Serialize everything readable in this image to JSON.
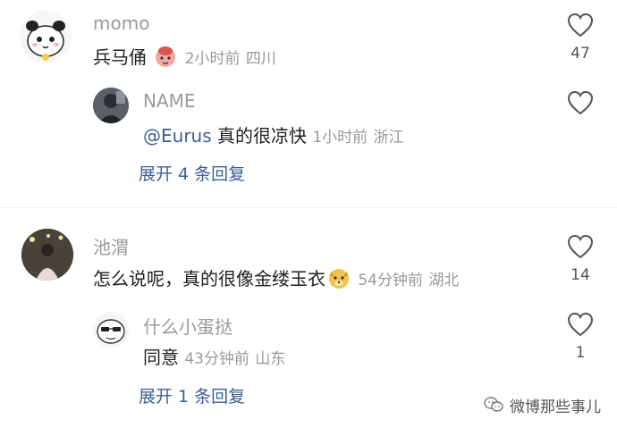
{
  "comments": [
    {
      "username": "momo",
      "text": "兵马俑",
      "emoji": "doll-emoji",
      "time": "2小时前",
      "location": "四川",
      "likes": "47",
      "replies": [
        {
          "username": "NAME",
          "mention": "@Eurus",
          "text": " 真的很凉快",
          "time": "1小时前",
          "location": "浙江",
          "likes": ""
        }
      ],
      "expand": "展开 4 条回复"
    },
    {
      "username": "池渭",
      "text": "怎么说呢，真的很像金缕玉衣",
      "emoji": "doge-emoji",
      "time": "54分钟前",
      "location": "湖北",
      "likes": "14",
      "replies": [
        {
          "username": "什么小蛋挞",
          "text": "同意",
          "time": "43分钟前",
          "location": "山东",
          "likes": "1"
        }
      ],
      "expand": "展开 1 条回复"
    }
  ],
  "watermark": "微博那些事儿",
  "icons": {
    "like": "heart-outline-icon",
    "wechat": "wechat-icon"
  }
}
